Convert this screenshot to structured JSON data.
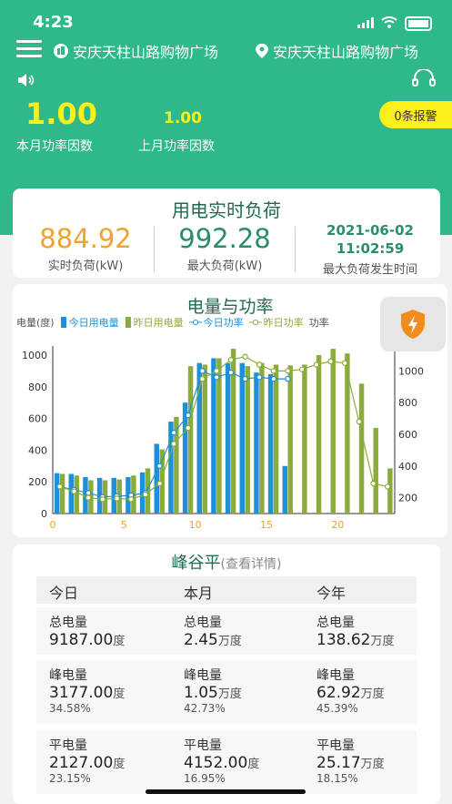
{
  "status": {
    "time": "4:23"
  },
  "topbar": {
    "station_left": "安庆天柱山路购物广场",
    "station_right": "安庆天柱山路购物广场"
  },
  "power_factor": {
    "this_month_value": "1.00",
    "this_month_label": "本月功率因数",
    "last_month_value": "1.00",
    "last_month_label": "上月功率因数",
    "alarm_label": "0条报警"
  },
  "load": {
    "title": "用电实时负荷",
    "realtime_value": "884.92",
    "realtime_label": "实时负荷(kW)",
    "max_value": "992.28",
    "max_label": "最大负荷(kW)",
    "max_date": "2021-06-02",
    "max_time": "11:02:59",
    "max_time_label": "最大负荷发生时间"
  },
  "chart_data": {
    "type": "bar",
    "title": "电量与功率",
    "ylabel": "电量(度)",
    "y2label": "功率",
    "legend": [
      "今日用电量",
      "昨日用电量",
      "今日功率",
      "昨日功率"
    ],
    "x": [
      0,
      1,
      2,
      3,
      4,
      5,
      6,
      7,
      8,
      9,
      10,
      11,
      12,
      13,
      14,
      15,
      16,
      17,
      18,
      19,
      20,
      21,
      22,
      23
    ],
    "xticks": [
      0,
      5,
      10,
      15,
      20
    ],
    "ylim": [
      0,
      1000
    ],
    "yticks": [
      0,
      200,
      400,
      600,
      800,
      1000
    ],
    "y2lim": [
      100,
      1100
    ],
    "y2ticks": [
      200,
      400,
      600,
      800,
      1000
    ],
    "colors": {
      "today_bar": "#1e90d8",
      "yesterday_bar": "#8bab3c",
      "today_line": "#1e90d8",
      "yesterday_line": "#8bab3c"
    },
    "series": [
      {
        "name": "今日用电量",
        "values": [
          255,
          250,
          230,
          225,
          225,
          230,
          260,
          440,
          580,
          700,
          950,
          980,
          950,
          950,
          890,
          880,
          300,
          null,
          null,
          null,
          null,
          null,
          null,
          null
        ]
      },
      {
        "name": "昨日用电量",
        "values": [
          250,
          240,
          210,
          210,
          215,
          240,
          285,
          405,
          610,
          930,
          940,
          980,
          1040,
          930,
          950,
          940,
          935,
          940,
          1000,
          1040,
          1010,
          820,
          540,
          285
        ]
      },
      {
        "name": "今日功率",
        "values": [
          270,
          250,
          230,
          205,
          210,
          215,
          230,
          400,
          610,
          720,
          1000,
          960,
          990,
          950,
          960,
          950,
          950,
          null,
          null,
          null,
          null,
          null,
          null,
          null
        ]
      },
      {
        "name": "昨日功率",
        "values": [
          270,
          240,
          200,
          190,
          195,
          190,
          220,
          290,
          540,
          640,
          950,
          1000,
          1070,
          1090,
          1040,
          1000,
          1000,
          1010,
          1040,
          1060,
          1050,
          680,
          290,
          270
        ]
      }
    ]
  },
  "peak": {
    "title": "峰谷平",
    "detail_link": "(查看详情)",
    "headers": [
      "今日",
      "本月",
      "今年"
    ],
    "rows": [
      {
        "label": "总电量",
        "cells": [
          {
            "v": "9187.00",
            "u": "度"
          },
          {
            "v": "2.45",
            "u": "万度"
          },
          {
            "v": "138.62",
            "u": "万度"
          }
        ]
      },
      {
        "label": "峰电量",
        "cells": [
          {
            "v": "3177.00",
            "u": "度",
            "p": "34.58%"
          },
          {
            "v": "1.05",
            "u": "万度",
            "p": "42.73%"
          },
          {
            "v": "62.92",
            "u": "万度",
            "p": "45.39%"
          }
        ]
      },
      {
        "label": "平电量",
        "cells": [
          {
            "v": "2127.00",
            "u": "度",
            "p": "23.15%"
          },
          {
            "v": "4152.00",
            "u": "度",
            "p": "16.95%"
          },
          {
            "v": "25.17",
            "u": "万度",
            "p": "18.15%"
          }
        ]
      }
    ]
  }
}
